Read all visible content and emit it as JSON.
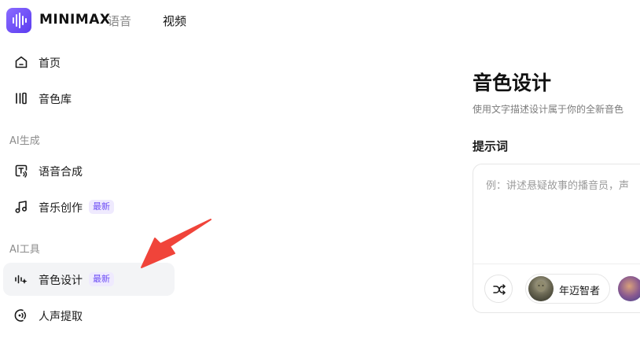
{
  "header": {
    "brand": "MINIMAX",
    "tabs": [
      {
        "label": "语音"
      },
      {
        "label": "视频"
      }
    ]
  },
  "sidebar": {
    "top_items": [
      {
        "label": "首页",
        "icon": "home-icon"
      },
      {
        "label": "音色库",
        "icon": "library-icon"
      }
    ],
    "sections": [
      {
        "title": "AI生成",
        "items": [
          {
            "label": "语音合成",
            "icon": "text-to-speech-icon"
          },
          {
            "label": "音乐创作",
            "icon": "music-note-icon",
            "badge": "最新"
          }
        ]
      },
      {
        "title": "AI工具",
        "items": [
          {
            "label": "音色设计",
            "icon": "voice-design-icon",
            "badge": "最新",
            "active": true
          },
          {
            "label": "人声提取",
            "icon": "voice-extract-icon"
          }
        ]
      }
    ]
  },
  "main": {
    "title": "音色设计",
    "subtitle": "使用文字描述设计属于你的全新音色",
    "prompt_label": "提示词",
    "prompt_placeholder": "例：讲述悬疑故事的播音员，声",
    "presets": [
      {
        "label": "年迈智者"
      }
    ]
  },
  "colors": {
    "accent": "#6d4ef5",
    "badge_bg": "#efeafe",
    "active_bg": "#f3f4f6",
    "annotation_arrow": "#f0443a"
  }
}
